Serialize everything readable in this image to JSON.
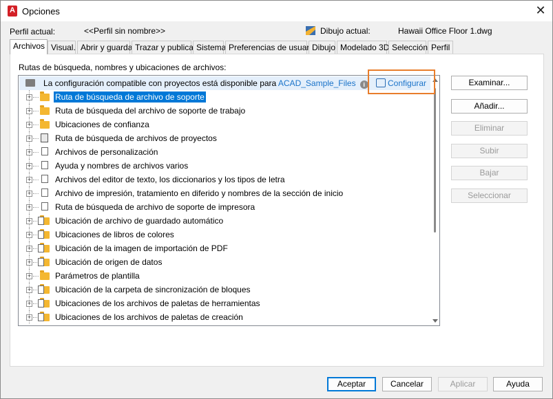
{
  "window": {
    "title": "Opciones",
    "close_glyph": "✕"
  },
  "profile": {
    "current_label": "Perfil actual:",
    "current_value": "<<Perfil sin nombre>>",
    "drawing_label": "Dibujo actual:",
    "drawing_value": "Hawaii Office Floor 1.dwg"
  },
  "tabs": [
    {
      "label": "Archivos",
      "active": true
    },
    {
      "label": "Visual."
    },
    {
      "label": "Abrir y guardar"
    },
    {
      "label": "Trazar y publicar"
    },
    {
      "label": "Sistema"
    },
    {
      "label": "Preferencias de usuario"
    },
    {
      "label": "Dibujo"
    },
    {
      "label": "Modelado 3D"
    },
    {
      "label": "Selección"
    },
    {
      "label": "Perfil"
    }
  ],
  "section_label": "Rutas de búsqueda, nombres y ubicaciones de archivos:",
  "banner": {
    "text": "La configuración compatible con proyectos está disponible para",
    "link": "ACAD_Sample_Files",
    "info_glyph": "i",
    "configure": "Configurar"
  },
  "tree_items": [
    {
      "label": "Ruta de búsqueda de archivo de soporte",
      "icon": "folder-icon",
      "selected": true
    },
    {
      "label": "Ruta de búsqueda del archivo de soporte de trabajo",
      "icon": "folder-icon"
    },
    {
      "label": "Ubicaciones de confianza",
      "icon": "folder-icon"
    },
    {
      "label": "Ruta de búsqueda de archivos de proyectos",
      "icon": "project-icon"
    },
    {
      "label": "Archivos de personalización",
      "icon": "documents-icon"
    },
    {
      "label": "Ayuda y nombres de archivos varios",
      "icon": "documents-icon"
    },
    {
      "label": "Archivos del editor de texto, los diccionarios y los tipos de letra",
      "icon": "documents-icon"
    },
    {
      "label": "Archivo de impresión, tratamiento en diferido y nombres de la sección de inicio",
      "icon": "documents-icon"
    },
    {
      "label": "Ruta de búsqueda de archivo de soporte de impresora",
      "icon": "documents-icon"
    },
    {
      "label": "Ubicación de archivo de guardado automático",
      "icon": "folder-document-icon"
    },
    {
      "label": "Ubicaciones de libros de colores",
      "icon": "folder-document-icon"
    },
    {
      "label": "Ubicación de la imagen de importación de PDF",
      "icon": "folder-document-icon"
    },
    {
      "label": "Ubicación de origen de datos",
      "icon": "folder-document-icon"
    },
    {
      "label": "Parámetros de plantilla",
      "icon": "folder-icon"
    },
    {
      "label": "Ubicación de la carpeta de sincronización de bloques",
      "icon": "folder-document-icon"
    },
    {
      "label": "Ubicaciones de los archivos de paletas de herramientas",
      "icon": "folder-document-icon"
    },
    {
      "label": "Ubicaciones de los archivos de paletas de creación",
      "icon": "folder-document-icon"
    }
  ],
  "side_buttons": {
    "examinar": "Examinar...",
    "anadir": "Añadir...",
    "eliminar": "Eliminar",
    "subir": "Subir",
    "bajar": "Bajar",
    "seleccionar": "Seleccionar"
  },
  "bottom_buttons": {
    "aceptar": "Aceptar",
    "cancelar": "Cancelar",
    "aplicar": "Aplicar",
    "ayuda": "Ayuda"
  },
  "colors": {
    "selection": "#0078d7",
    "highlight_box": "#e87d2b",
    "link": "#1a73c9",
    "folder": "#f4b731",
    "app_icon": "#d31f26"
  }
}
